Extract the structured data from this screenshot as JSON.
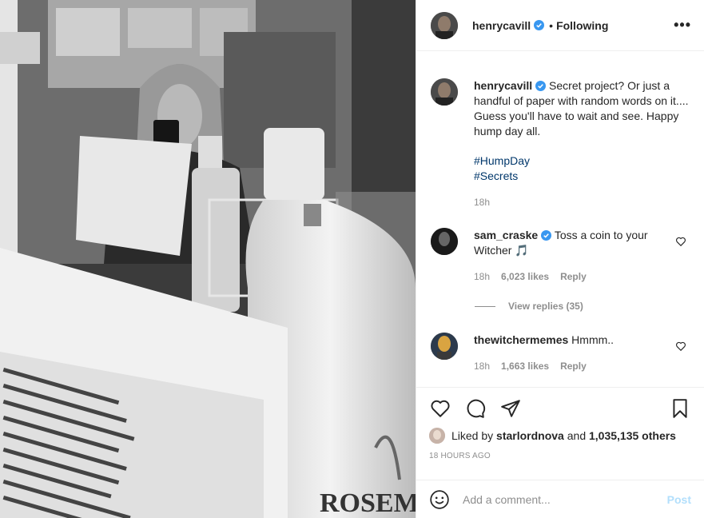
{
  "header": {
    "username": "henrycavill",
    "dot": "•",
    "follow_status": "Following",
    "more": "•••"
  },
  "caption": {
    "username": "henrycavill",
    "text": "Secret project? Or just a handful of paper with random words on it.... Guess you'll have to wait and see. Happy hump day all.",
    "tags": [
      "#HumpDay",
      "#Secrets"
    ],
    "time": "18h"
  },
  "comments": [
    {
      "username": "sam_craske",
      "text": "Toss a coin to your Witcher",
      "emoji": "🎵",
      "time": "18h",
      "likes": "6,023 likes",
      "reply": "Reply",
      "view_replies": "View replies (35)"
    },
    {
      "username": "thewitchermemes",
      "text": "Hmmm..",
      "time": "18h",
      "likes": "1,663 likes",
      "reply": "Reply"
    }
  ],
  "actions": {
    "liked_by_prefix": "Liked by",
    "liked_by_user": "starlordnova",
    "liked_by_and": "and",
    "liked_by_others": "1,035,135 others",
    "timestamp": "18 HOURS AGO"
  },
  "add_comment": {
    "placeholder": "Add a comment...",
    "post_label": "Post"
  },
  "colors": {
    "verified": "#3897f0",
    "link": "#00376b",
    "muted": "#8e8e8e",
    "post_disabled": "#b2dffc"
  }
}
